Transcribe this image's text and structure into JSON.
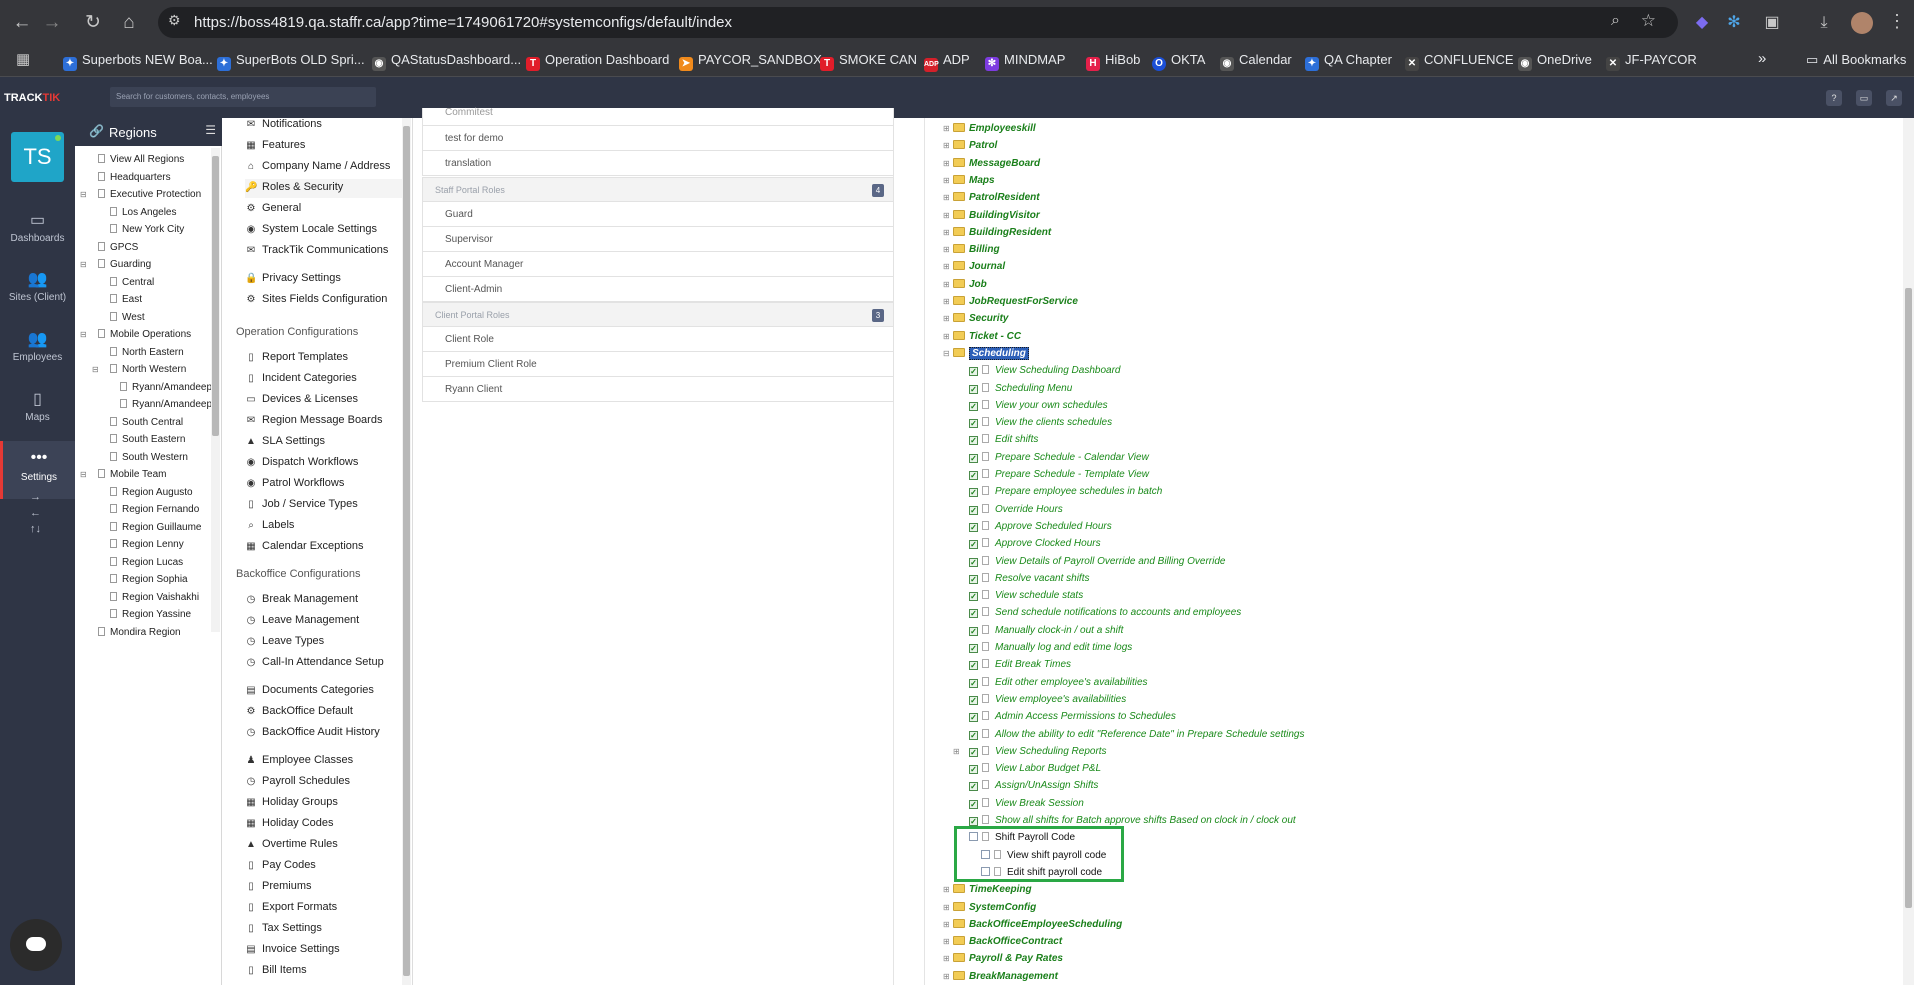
{
  "browser": {
    "url": "https://boss4819.qa.staffr.ca/app?time=1749061720#systemconfigs/default/index",
    "bookmarks": [
      "Superbots NEW Boa...",
      "SuperBots OLD Spri...",
      "QAStatusDashboard...",
      "Operation Dashboard",
      "PAYCOR_SANDBOX",
      "SMOKE CAN",
      "ADP",
      "MINDMAP",
      "HiBob",
      "OKTA",
      "Calendar",
      "QA Chapter",
      "CONFLUENCE",
      "OneDrive",
      "JF-PAYCOR"
    ],
    "all_bookmarks": "All Bookmarks",
    "more": "»"
  },
  "app": {
    "logo_a": "TRACK",
    "logo_b": "TIK",
    "search_placeholder": "Search for customers, contacts, employees",
    "header_icons": [
      "?",
      "▭",
      "↗"
    ]
  },
  "rail": {
    "avatar": "TS",
    "items": [
      {
        "label": "Dashboards",
        "icon": "▭"
      },
      {
        "label": "Sites (Client)",
        "icon": "👥"
      },
      {
        "label": "Employees",
        "icon": "👥"
      },
      {
        "label": "Maps",
        "icon": "▯"
      },
      {
        "label": "Settings",
        "icon": "•••"
      }
    ],
    "small": [
      "→",
      "←",
      "↑↓"
    ]
  },
  "regions": {
    "title": "Regions",
    "items": [
      {
        "label": "View All Regions",
        "level": 1
      },
      {
        "label": "Headquarters",
        "level": 1
      },
      {
        "label": "Executive Protection",
        "level": 1,
        "toggle": "⊟"
      },
      {
        "label": "Los Angeles",
        "level": 2
      },
      {
        "label": "New York City",
        "level": 2
      },
      {
        "label": "GPCS",
        "level": 1
      },
      {
        "label": "Guarding",
        "level": 1,
        "toggle": "⊟"
      },
      {
        "label": "Central",
        "level": 2
      },
      {
        "label": "East",
        "level": 2
      },
      {
        "label": "West",
        "level": 2
      },
      {
        "label": "Mobile Operations",
        "level": 1,
        "toggle": "⊟"
      },
      {
        "label": "North Eastern",
        "level": 2
      },
      {
        "label": "North Western",
        "level": 2,
        "toggle": "⊟"
      },
      {
        "label": "Ryann/Amandeep",
        "level": 3
      },
      {
        "label": "Ryann/Amandeep",
        "level": 3
      },
      {
        "label": "South Central",
        "level": 2
      },
      {
        "label": "South Eastern",
        "level": 2
      },
      {
        "label": "South Western",
        "level": 2
      },
      {
        "label": "Mobile Team",
        "level": 1,
        "toggle": "⊟"
      },
      {
        "label": "Region Augusto",
        "level": 2
      },
      {
        "label": "Region Fernando",
        "level": 2
      },
      {
        "label": "Region Guillaume",
        "level": 2
      },
      {
        "label": "Region Lenny",
        "level": 2
      },
      {
        "label": "Region Lucas",
        "level": 2
      },
      {
        "label": "Region Sophia",
        "level": 2
      },
      {
        "label": "Region Vaishakhi",
        "level": 2
      },
      {
        "label": "Region Yassine",
        "level": 2
      },
      {
        "label": "Mondira Region",
        "level": 1
      }
    ]
  },
  "settings": {
    "top_items": [
      {
        "label": "Notifications",
        "icon": "✉"
      },
      {
        "label": "Features",
        "icon": "▦"
      },
      {
        "label": "Company Name / Address",
        "icon": "⌂"
      },
      {
        "label": "Roles & Security",
        "icon": "🔑"
      },
      {
        "label": "General",
        "icon": "⚙"
      },
      {
        "label": "System Locale Settings",
        "icon": "◉"
      },
      {
        "label": "TrackTik Communications",
        "icon": "✉"
      },
      {
        "label": "Privacy Settings",
        "icon": "🔒"
      },
      {
        "label": "Sites Fields Configuration",
        "icon": "⚙"
      }
    ],
    "operation_title": "Operation Configurations",
    "operation_items": [
      {
        "label": "Report Templates",
        "icon": "▯"
      },
      {
        "label": "Incident Categories",
        "icon": "▯"
      },
      {
        "label": "Devices & Licenses",
        "icon": "▭"
      },
      {
        "label": "Region Message Boards",
        "icon": "✉"
      },
      {
        "label": "SLA Settings",
        "icon": "▲"
      },
      {
        "label": "Dispatch Workflows",
        "icon": "◉"
      },
      {
        "label": "Patrol Workflows",
        "icon": "◉"
      },
      {
        "label": "Job / Service Types",
        "icon": "▯"
      },
      {
        "label": "Labels",
        "icon": "⌕"
      },
      {
        "label": "Calendar Exceptions",
        "icon": "▦"
      }
    ],
    "backoffice_title": "Backoffice Configurations",
    "backoffice_items": [
      {
        "label": "Break Management",
        "icon": "◷"
      },
      {
        "label": "Leave Management",
        "icon": "◷"
      },
      {
        "label": "Leave Types",
        "icon": "◷"
      },
      {
        "label": "Call-In Attendance Setup",
        "icon": "◷"
      },
      {
        "label": "Documents Categories",
        "icon": "▤"
      },
      {
        "label": "BackOffice Default",
        "icon": "⚙"
      },
      {
        "label": "BackOffice Audit History",
        "icon": "◷"
      },
      {
        "label": "Employee Classes",
        "icon": "♟"
      },
      {
        "label": "Payroll Schedules",
        "icon": "◷"
      },
      {
        "label": "Holiday Groups",
        "icon": "▦"
      },
      {
        "label": "Holiday Codes",
        "icon": "▦"
      },
      {
        "label": "Overtime Rules",
        "icon": "▲"
      },
      {
        "label": "Pay Codes",
        "icon": "▯"
      },
      {
        "label": "Premiums",
        "icon": "▯"
      },
      {
        "label": "Export Formats",
        "icon": "▯"
      },
      {
        "label": "Tax Settings",
        "icon": "▯"
      },
      {
        "label": "Invoice Settings",
        "icon": "▤"
      },
      {
        "label": "Bill Items",
        "icon": "▯"
      }
    ]
  },
  "roles": {
    "cut_top": "Commitest",
    "above": [
      "test for demo",
      "translation"
    ],
    "staff_header": "Staff Portal Roles",
    "staff_count": "4",
    "staff": [
      "Guard",
      "Supervisor",
      "Account Manager",
      "Client-Admin"
    ],
    "client_header": "Client Portal Roles",
    "client_count": "3",
    "client": [
      "Client Role",
      "Premium Client Role",
      "Ryann Client"
    ]
  },
  "perms": {
    "folders_top": [
      "Employeeskill",
      "Patrol",
      "MessageBoard",
      "Maps",
      "PatrolResident",
      "BuildingVisitor",
      "BuildingResident",
      "Billing",
      "Journal",
      "Job",
      "JobRequestForService",
      "Security",
      "Ticket - CC"
    ],
    "selected": "Scheduling",
    "scheduling_children": [
      "View Scheduling Dashboard",
      "Scheduling Menu",
      "View your own schedules",
      "View the clients schedules",
      "Edit shifts",
      "Prepare Schedule - Calendar View",
      "Prepare Schedule - Template View",
      "Prepare employee schedules in batch",
      "Override Hours",
      "Approve Scheduled Hours",
      "Approve Clocked Hours",
      "View Details of Payroll Override and Billing Override",
      "Resolve vacant shifts",
      "View schedule stats",
      "Send schedule notifications to accounts and employees",
      "Manually clock-in / out a shift",
      "Manually log and edit time logs",
      "Edit Break Times",
      "Edit other employee's availabilities",
      "View employee's availabilities",
      "Admin Access Permissions to Schedules",
      "Allow the ability to edit \"Reference Date\" in Prepare Schedule settings",
      "View Scheduling Reports",
      "View Labor Budget P&L",
      "Assign/UnAssign Shifts",
      "View Break Session",
      "Show all shifts for Batch approve shifts Based on clock in / clock out"
    ],
    "shift_payroll": "Shift Payroll Code",
    "shift_payroll_children": [
      "View shift payroll code",
      "Edit shift payroll code"
    ],
    "folders_bottom": [
      "TimeKeeping",
      "SystemConfig",
      "BackOfficeEmployeeScheduling",
      "BackOfficeContract",
      "Payroll & Pay Rates",
      "BreakManagement"
    ]
  },
  "colors": {
    "accent": "#2aa845",
    "rail": "#2f3545",
    "perm_green": "#1a8a1a"
  }
}
